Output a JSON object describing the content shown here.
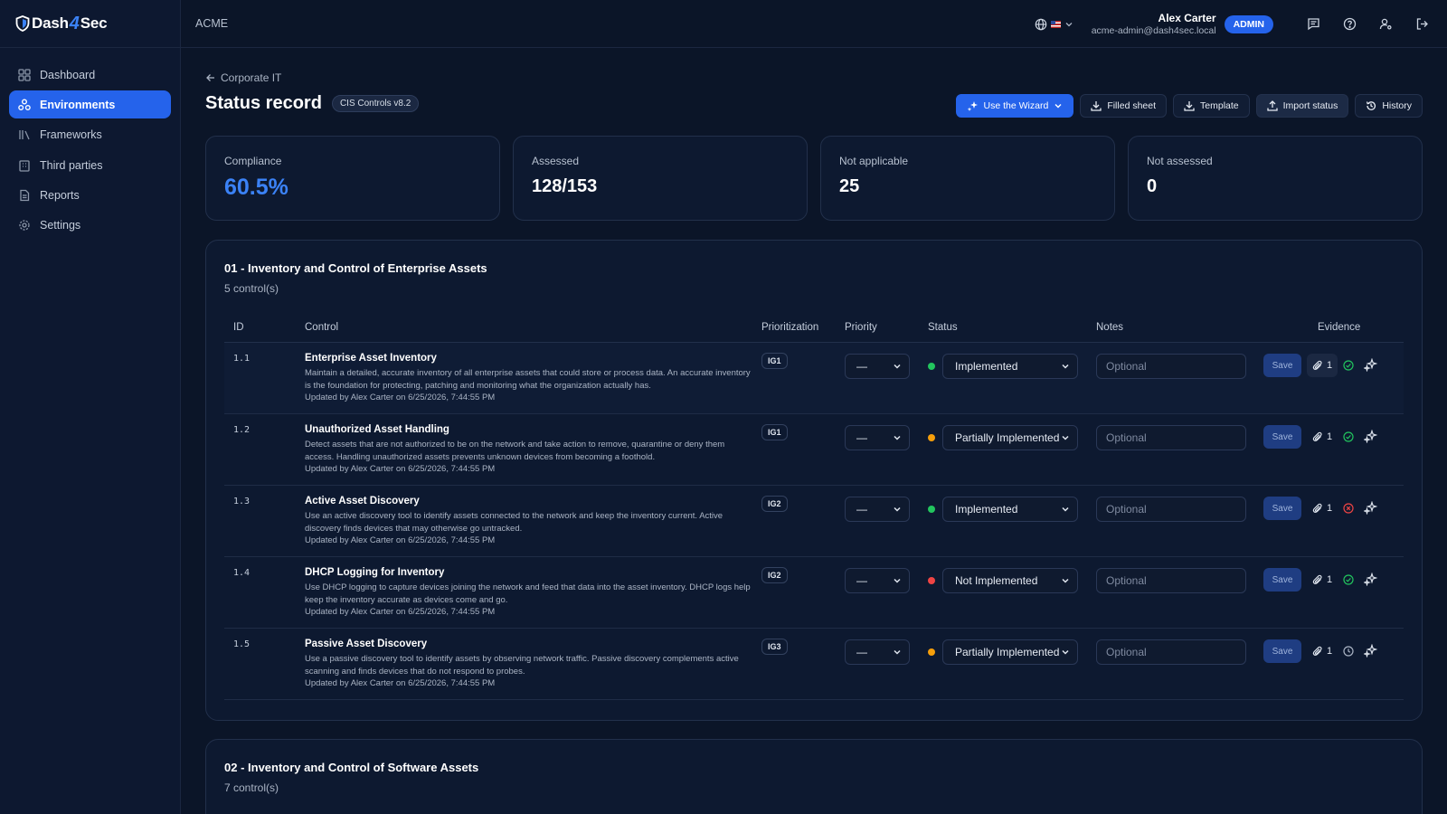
{
  "brand": {
    "name_left": "Dash",
    "name_mid": "4",
    "name_right": "Sec"
  },
  "sidebar": {
    "items": [
      {
        "label": "Dashboard",
        "icon": "dashboard-icon",
        "active": false
      },
      {
        "label": "Environments",
        "icon": "environments-icon",
        "active": true
      },
      {
        "label": "Frameworks",
        "icon": "frameworks-icon",
        "active": false
      },
      {
        "label": "Third parties",
        "icon": "building-icon",
        "active": false
      },
      {
        "label": "Reports",
        "icon": "report-icon",
        "active": false
      },
      {
        "label": "Settings",
        "icon": "gear-icon",
        "active": false
      }
    ]
  },
  "topbar": {
    "org": "ACME",
    "user_name": "Alex Carter",
    "user_email": "acme-admin@dash4sec.local",
    "role": "ADMIN"
  },
  "page": {
    "back_label": "Corporate IT",
    "title": "Status record",
    "framework": "CIS Controls v8.2",
    "actions": {
      "wizard": "Use the Wizard",
      "filled": "Filled sheet",
      "template": "Template",
      "import": "Import status",
      "history": "History"
    }
  },
  "stats": [
    {
      "label": "Compliance",
      "value": "60.5%"
    },
    {
      "label": "Assessed",
      "value": "128/153"
    },
    {
      "label": "Not applicable",
      "value": "25"
    },
    {
      "label": "Not assessed",
      "value": "0"
    }
  ],
  "table_headers": {
    "id": "ID",
    "control": "Control",
    "prioritization": "Prioritization",
    "priority": "Priority",
    "status": "Status",
    "notes": "Notes",
    "evidence": "Evidence"
  },
  "sections": [
    {
      "title": "01 - Inventory and Control of Enterprise Assets",
      "count": "5 control(s)",
      "rows": [
        {
          "id": "1.1",
          "name": "Enterprise Asset Inventory",
          "desc": "Maintain a detailed, accurate inventory of all enterprise assets that could store or process data. An accurate inventory is the foundation for protecting, patching and monitoring what the organization actually has.",
          "updated": "Updated by Alex Carter on 6/25/2026, 7:44:55 PM",
          "ig": "IG1",
          "priority": "—",
          "status": "Implemented",
          "status_color": "#22c55e",
          "notes_placeholder": "Optional",
          "save": "Save",
          "attachments": "1",
          "evidence_state": "ok"
        },
        {
          "id": "1.2",
          "name": "Unauthorized Asset Handling",
          "desc": "Detect assets that are not authorized to be on the network and take action to remove, quarantine or deny them access. Handling unauthorized assets prevents unknown devices from becoming a foothold.",
          "updated": "Updated by Alex Carter on 6/25/2026, 7:44:55 PM",
          "ig": "IG1",
          "priority": "—",
          "status": "Partially Implemented",
          "status_color": "#f59e0b",
          "notes_placeholder": "Optional",
          "save": "Save",
          "attachments": "1",
          "evidence_state": "ok"
        },
        {
          "id": "1.3",
          "name": "Active Asset Discovery",
          "desc": "Use an active discovery tool to identify assets connected to the network and keep the inventory current. Active discovery finds devices that may otherwise go untracked.",
          "updated": "Updated by Alex Carter on 6/25/2026, 7:44:55 PM",
          "ig": "IG2",
          "priority": "—",
          "status": "Implemented",
          "status_color": "#22c55e",
          "notes_placeholder": "Optional",
          "save": "Save",
          "attachments": "1",
          "evidence_state": "rejected"
        },
        {
          "id": "1.4",
          "name": "DHCP Logging for Inventory",
          "desc": "Use DHCP logging to capture devices joining the network and feed that data into the asset inventory. DHCP logs help keep the inventory accurate as devices come and go.",
          "updated": "Updated by Alex Carter on 6/25/2026, 7:44:55 PM",
          "ig": "IG2",
          "priority": "—",
          "status": "Not Implemented",
          "status_color": "#ef4444",
          "notes_placeholder": "Optional",
          "save": "Save",
          "attachments": "1",
          "evidence_state": "ok"
        },
        {
          "id": "1.5",
          "name": "Passive Asset Discovery",
          "desc": "Use a passive discovery tool to identify assets by observing network traffic. Passive discovery complements active scanning and finds devices that do not respond to probes.",
          "updated": "Updated by Alex Carter on 6/25/2026, 7:44:55 PM",
          "ig": "IG3",
          "priority": "—",
          "status": "Partially Implemented",
          "status_color": "#f59e0b",
          "notes_placeholder": "Optional",
          "save": "Save",
          "attachments": "1",
          "evidence_state": "pending"
        }
      ]
    },
    {
      "title": "02 - Inventory and Control of Software Assets",
      "count": "7 control(s)",
      "rows": []
    }
  ],
  "colors": {
    "accent": "#2563eb",
    "background": "#0b1528",
    "card": "#0d1930",
    "ok": "#22c55e",
    "warn": "#f59e0b",
    "bad": "#ef4444"
  }
}
